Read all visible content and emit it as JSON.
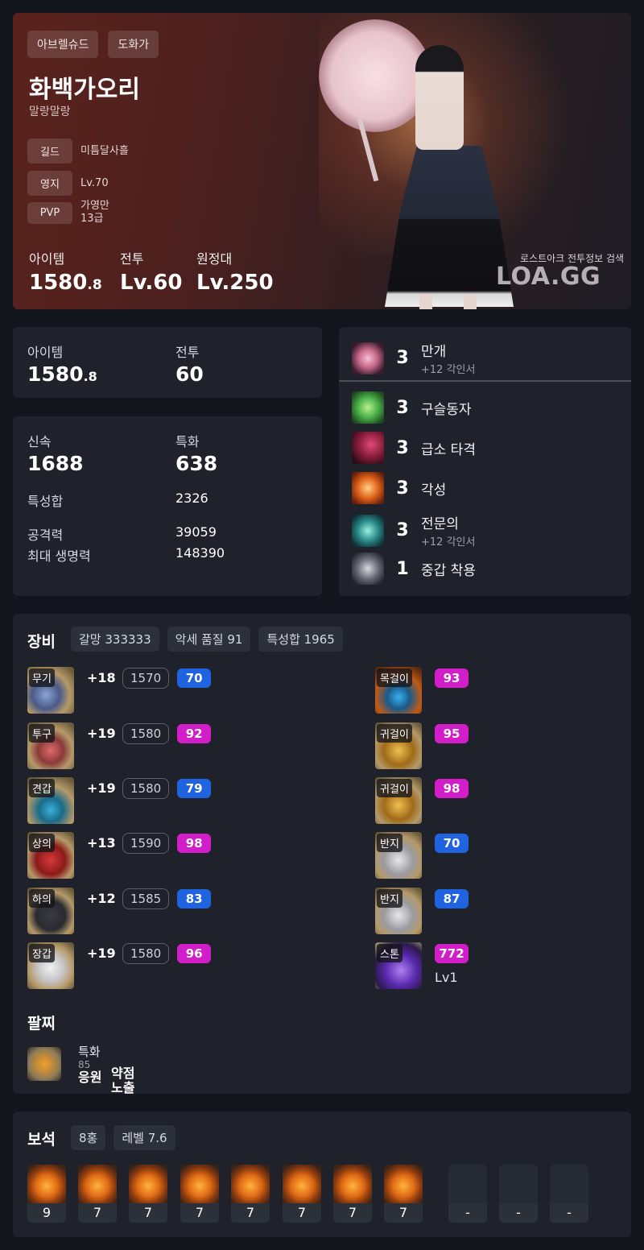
{
  "hero": {
    "tags": [
      "아브렐슈드",
      "도화가"
    ],
    "name": "화백가오리",
    "title": "말랑말랑",
    "guild_label": "길드",
    "guild_value": "미틈달사흘",
    "estate_label": "영지",
    "estate_value": "Lv.70",
    "pvp_label": "PVP",
    "pvp_value_line1": "가영만",
    "pvp_value_line2": "13급",
    "stats": {
      "item_label": "아이템",
      "item_value": "1580",
      "item_decimal": ".8",
      "combat_label": "전투",
      "combat_value": "Lv.60",
      "expedition_label": "원정대",
      "expedition_value": "Lv.250"
    },
    "watermark_small": "로스트아크 전투정보 검색",
    "watermark_big": "LOA.GG"
  },
  "summary": {
    "item_label": "아이템",
    "item_value": "1580",
    "item_decimal": ".8",
    "combat_label": "전투",
    "combat_value": "60"
  },
  "combat_stats": {
    "swift_label": "신속",
    "swift_value": "1688",
    "crit_label": "특화",
    "crit_value": "638",
    "total_label": "특성합",
    "total_value": "2326",
    "atk_label": "공격력",
    "atk_value": "39059",
    "hp_label": "최대 생명력",
    "hp_value": "148390"
  },
  "engravings": [
    {
      "level": "3",
      "name": "만개",
      "sub": "+12 각인서",
      "icon_color": "#c86a8a"
    },
    {
      "level": "3",
      "name": "구슬동자",
      "sub": "",
      "icon_color": "#4bb04a"
    },
    {
      "level": "3",
      "name": "급소 타격",
      "sub": "",
      "icon_color": "#8a1e3c"
    },
    {
      "level": "3",
      "name": "각성",
      "sub": "",
      "icon_color": "#e0641a"
    },
    {
      "level": "3",
      "name": "전문의",
      "sub": "+12 각인서",
      "icon_color": "#2a8a8a"
    },
    {
      "level": "1",
      "name": "중갑 착용",
      "sub": "",
      "icon_color": "#6a6e78"
    }
  ],
  "equipment": {
    "title": "장비",
    "chips": [
      "갈망 333333",
      "악세 품질 91",
      "특성합 1965"
    ],
    "armor": [
      {
        "slot": "무기",
        "plus": "+18",
        "ilvl": "1570",
        "quality": "70",
        "q_color": "blue"
      },
      {
        "slot": "투구",
        "plus": "+19",
        "ilvl": "1580",
        "quality": "92",
        "q_color": "pink"
      },
      {
        "slot": "견갑",
        "plus": "+19",
        "ilvl": "1580",
        "quality": "79",
        "q_color": "blue"
      },
      {
        "slot": "상의",
        "plus": "+13",
        "ilvl": "1590",
        "quality": "98",
        "q_color": "pink"
      },
      {
        "slot": "하의",
        "plus": "+12",
        "ilvl": "1585",
        "quality": "83",
        "q_color": "blue"
      },
      {
        "slot": "장갑",
        "plus": "+19",
        "ilvl": "1580",
        "quality": "96",
        "q_color": "pink"
      }
    ],
    "accessories": [
      {
        "slot": "목걸이",
        "quality": "93",
        "q_color": "pink"
      },
      {
        "slot": "귀걸이",
        "quality": "95",
        "q_color": "pink"
      },
      {
        "slot": "귀걸이",
        "quality": "98",
        "q_color": "pink"
      },
      {
        "slot": "반지",
        "quality": "70",
        "q_color": "blue"
      },
      {
        "slot": "반지",
        "quality": "87",
        "q_color": "blue"
      },
      {
        "slot": "스톤",
        "quality": "772",
        "q_color": "pink",
        "extra": "Lv1"
      }
    ],
    "bracelet_title": "팔찌",
    "bracelet_stat_line1": "특화",
    "bracelet_stat_line2": "85",
    "bracelet_effect1": "응원",
    "bracelet_effect2_line1": "약점",
    "bracelet_effect2_line2": "노출"
  },
  "gems": {
    "title": "보석",
    "chips": [
      "8홍",
      "레벨 7.6"
    ],
    "levels": [
      "9",
      "7",
      "7",
      "7",
      "7",
      "7",
      "7",
      "7",
      "-",
      "-",
      "-"
    ]
  }
}
